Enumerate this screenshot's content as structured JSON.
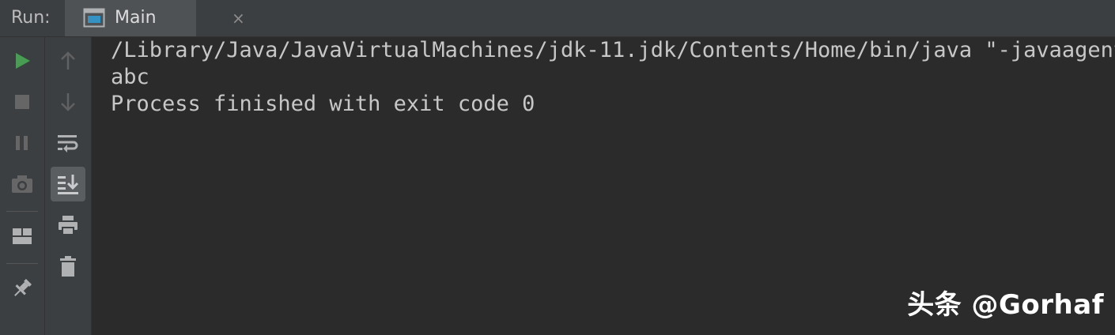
{
  "header": {
    "run_label": "Run:",
    "tab_label": "Main",
    "tab_close": "×"
  },
  "toolbar_left": [
    {
      "name": "rerun-icon",
      "color": "#4caf50"
    },
    {
      "name": "stop-icon",
      "color": "#6e6e6e"
    },
    {
      "name": "pause-icon",
      "color": "#6e6e6e"
    },
    {
      "name": "camera-icon",
      "color": "#6e6e6e"
    },
    {
      "name": "layout-icon",
      "color": "#afb1b3"
    },
    {
      "name": "pin-icon",
      "color": "#afb1b3"
    }
  ],
  "toolbar_right": [
    {
      "name": "arrow-up-icon"
    },
    {
      "name": "arrow-down-icon"
    },
    {
      "name": "soft-wrap-icon"
    },
    {
      "name": "scroll-to-end-icon",
      "active": true
    },
    {
      "name": "print-icon"
    },
    {
      "name": "trash-icon"
    }
  ],
  "console": {
    "lines": [
      "/Library/Java/JavaVirtualMachines/jdk-11.jdk/Contents/Home/bin/java \"-javaagent:",
      "abc",
      "Process finished with exit code 0"
    ]
  },
  "watermark": "头条 @Gorhaf"
}
